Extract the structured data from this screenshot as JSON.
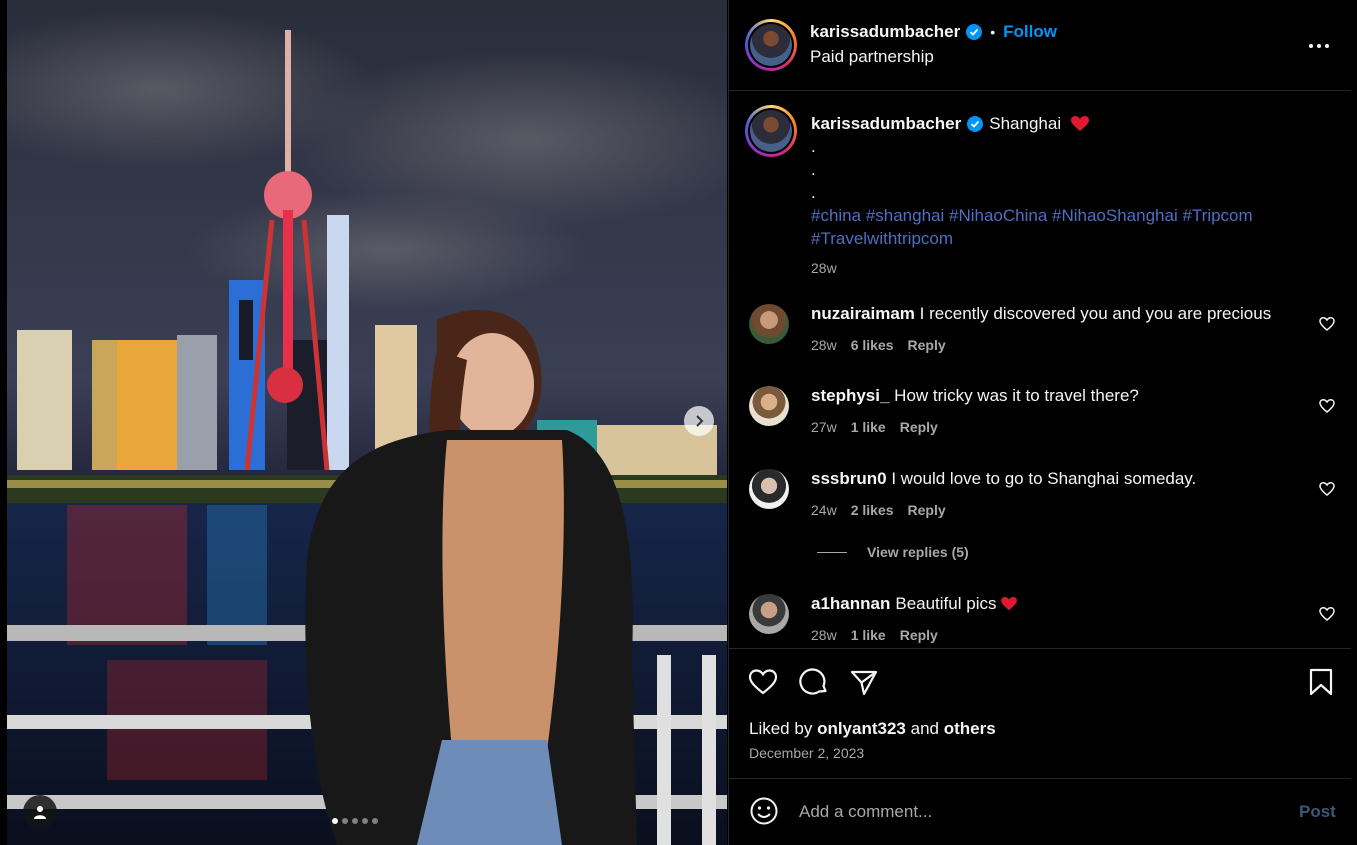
{
  "post": {
    "username": "karissadumbacher",
    "follow_label": "Follow",
    "separator": "•",
    "subtitle": "Paid partnership",
    "caption": {
      "location_text": "Shanghai",
      "dots": [
        ".",
        ".",
        "."
      ],
      "hashtags_line1": "#china #shanghai #NihaoChina #NihaoShanghai #Tripcom",
      "hashtags_line2": "#Travelwithtripcom",
      "time": "28w"
    }
  },
  "comments": [
    {
      "username": "nuzairaimam",
      "text": "I recently discovered you and you are precious",
      "time": "28w",
      "likes": "6 likes",
      "reply": "Reply"
    },
    {
      "username": "stephysi_",
      "text": "How tricky was it to travel there?",
      "time": "27w",
      "likes": "1 like",
      "reply": "Reply"
    },
    {
      "username": "sssbrun0",
      "text": "I would love to go to Shanghai someday.",
      "time": "24w",
      "likes": "2 likes",
      "reply": "Reply"
    },
    {
      "username": "a1hannan",
      "text": "Beautiful pics",
      "time": "28w",
      "likes": "1 like",
      "reply": "Reply"
    }
  ],
  "view_replies": "View replies (5)",
  "likes": {
    "prefix": "Liked by",
    "user": "onlyant323",
    "and": "and",
    "others": "others"
  },
  "date": "December 2, 2023",
  "add_comment": {
    "placeholder": "Add a comment...",
    "post_label": "Post"
  },
  "carousel": {
    "count": 5,
    "active": 0
  },
  "colors": {
    "follow": "#0095f6",
    "hashtag": "#4f6ec4",
    "verified": "#0095f6",
    "heart": "#ff3040"
  },
  "icons": [
    "verified-badge-icon",
    "more-options-icon",
    "heart-icon",
    "comment-icon",
    "share-icon",
    "bookmark-icon",
    "emoji-icon",
    "chevron-right-icon",
    "user-tag-icon"
  ]
}
